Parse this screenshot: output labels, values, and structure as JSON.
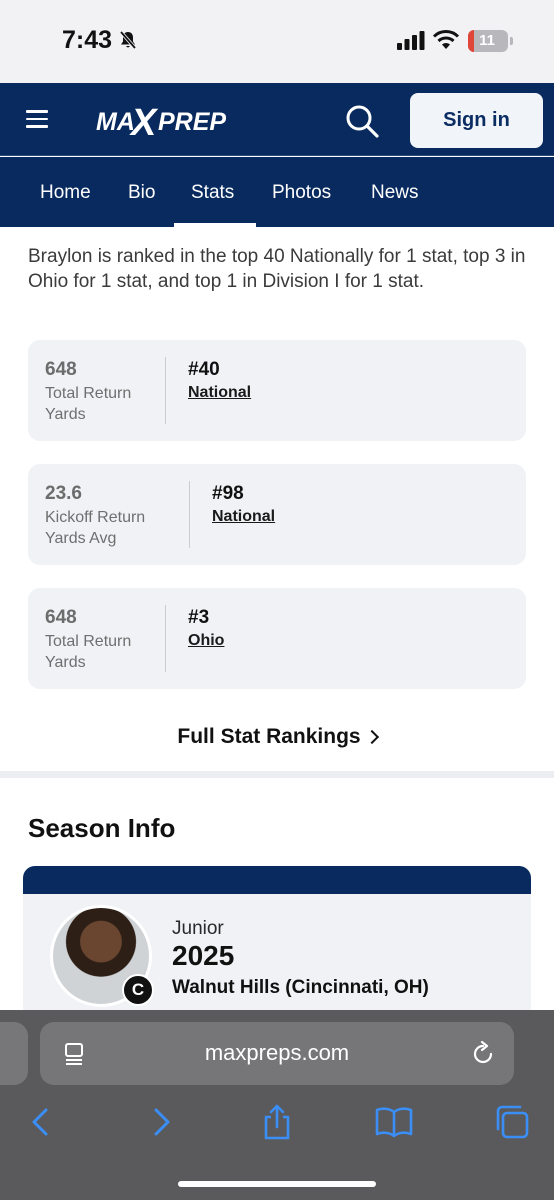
{
  "status_bar": {
    "time": "7:43",
    "battery": "11"
  },
  "header": {
    "logo_text": "MAXPREPS",
    "sign_in_label": "Sign in"
  },
  "nav": {
    "tabs": [
      "Home",
      "Bio",
      "Stats",
      "Photos",
      "News"
    ],
    "active_tab": "Stats"
  },
  "rankings": {
    "intro": "Braylon is ranked in the top 40 Nationally for 1 stat, top 3 in Ohio for 1 stat, and top 1 in Division I for 1 stat.",
    "cards": [
      {
        "value": "648",
        "label": "Total Return Yards",
        "rank": "#40",
        "scope": "National"
      },
      {
        "value": "23.6",
        "label": "Kickoff Return Yards Avg",
        "rank": "#98",
        "scope": "National"
      },
      {
        "value": "648",
        "label": "Total Return Yards",
        "rank": "#3",
        "scope": "Ohio"
      }
    ],
    "full_link": "Full Stat Rankings"
  },
  "season_info": {
    "title": "Season Info",
    "class": "Junior",
    "year": "2025",
    "school": "Walnut Hills (Cincinnati, OH)",
    "team_badge": "C"
  },
  "browser": {
    "url": "maxpreps.com"
  },
  "colors": {
    "brand_navy": "#082a5e",
    "card_bg": "#f0f2f5",
    "safari_blue": "#3a8ef6"
  }
}
